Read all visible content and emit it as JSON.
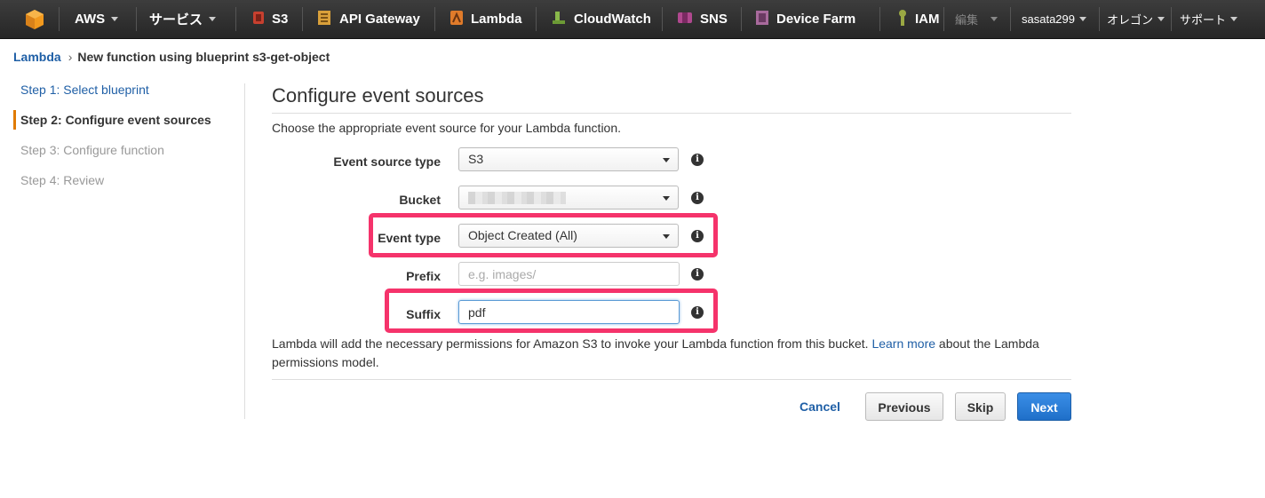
{
  "nav": {
    "aws_label": "AWS",
    "services_label": "サービス",
    "services": [
      {
        "label": "S3",
        "icon": "s3-icon",
        "color": "#c7402f"
      },
      {
        "label": "API Gateway",
        "icon": "api-gateway-icon",
        "color": "#d9a03a"
      },
      {
        "label": "Lambda",
        "icon": "lambda-icon",
        "color": "#e07b2a"
      },
      {
        "label": "CloudWatch",
        "icon": "cloudwatch-icon",
        "color": "#6c9a35"
      },
      {
        "label": "SNS",
        "icon": "sns-icon",
        "color": "#b0488f"
      },
      {
        "label": "Device Farm",
        "icon": "device-farm-icon",
        "color": "#a86a9c"
      },
      {
        "label": "IAM",
        "icon": "iam-icon",
        "color": "#9aa843"
      }
    ],
    "edit_label": "編集",
    "user_label": "sasata299",
    "region_label": "オレゴン",
    "support_label": "サポート"
  },
  "breadcrumb": {
    "root": "Lambda",
    "current": "New function using blueprint s3-get-object"
  },
  "steps": [
    {
      "label": "Step 1: Select blueprint",
      "state": "done"
    },
    {
      "label": "Step 2: Configure event sources",
      "state": "active"
    },
    {
      "label": "Step 3: Configure function",
      "state": "pending"
    },
    {
      "label": "Step 4: Review",
      "state": "pending"
    }
  ],
  "main": {
    "title": "Configure event sources",
    "description": "Choose the appropriate event source for your Lambda function."
  },
  "form": {
    "event_source_type": {
      "label": "Event source type",
      "value": "S3"
    },
    "bucket": {
      "label": "Bucket"
    },
    "event_type": {
      "label": "Event type",
      "value": "Object Created (All)"
    },
    "prefix": {
      "label": "Prefix",
      "placeholder": "e.g. images/",
      "value": ""
    },
    "suffix": {
      "label": "Suffix",
      "value": "pdf"
    }
  },
  "note": {
    "before_link": "Lambda will add the necessary permissions for Amazon S3 to invoke your Lambda function from this bucket. ",
    "link": "Learn more",
    "after_link": " about the Lambda permissions model."
  },
  "buttons": {
    "cancel": "Cancel",
    "previous": "Previous",
    "skip": "Skip",
    "next": "Next"
  },
  "colors": {
    "highlight": "#f5336b",
    "link": "#1f5fa6",
    "primary": "#1f6fc9",
    "step_accent": "#e07b00"
  }
}
